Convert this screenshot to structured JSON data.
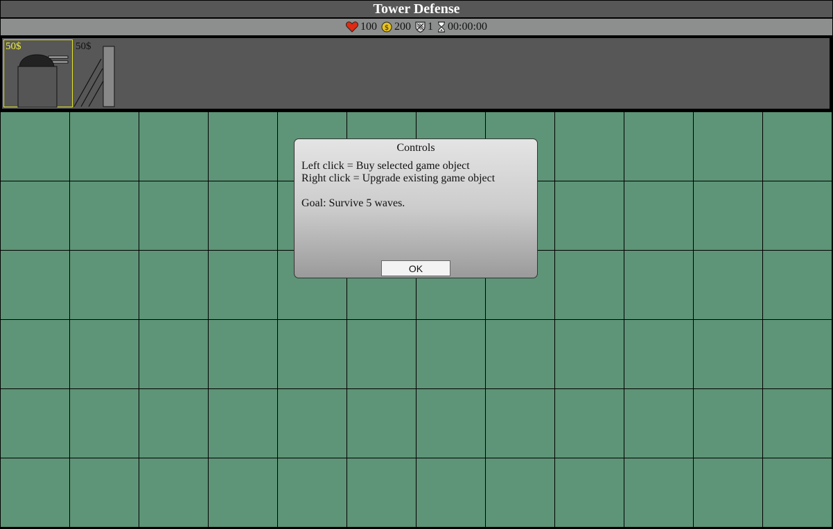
{
  "title": "Tower Defense",
  "status": {
    "lives": "100",
    "money": "200",
    "wave": "1",
    "time": "00:00:00",
    "icons": [
      "heart-icon",
      "coin-icon",
      "shield-icon",
      "hourglass-icon"
    ]
  },
  "shop": {
    "items": [
      {
        "price": "50$",
        "icon": "cannon-tower-icon",
        "selected": true
      },
      {
        "price": "50$",
        "icon": "wall-icon",
        "selected": false
      }
    ],
    "selected_color": "#f2f233"
  },
  "board": {
    "columns": 12,
    "rows": 6,
    "cell_color": "#5e9477"
  },
  "dialog": {
    "title": "Controls",
    "line1": "Left click = Buy selected game object",
    "line2": "Right click = Upgrade existing game object",
    "line3": "Goal: Survive 5 waves.",
    "ok_label": "OK"
  }
}
